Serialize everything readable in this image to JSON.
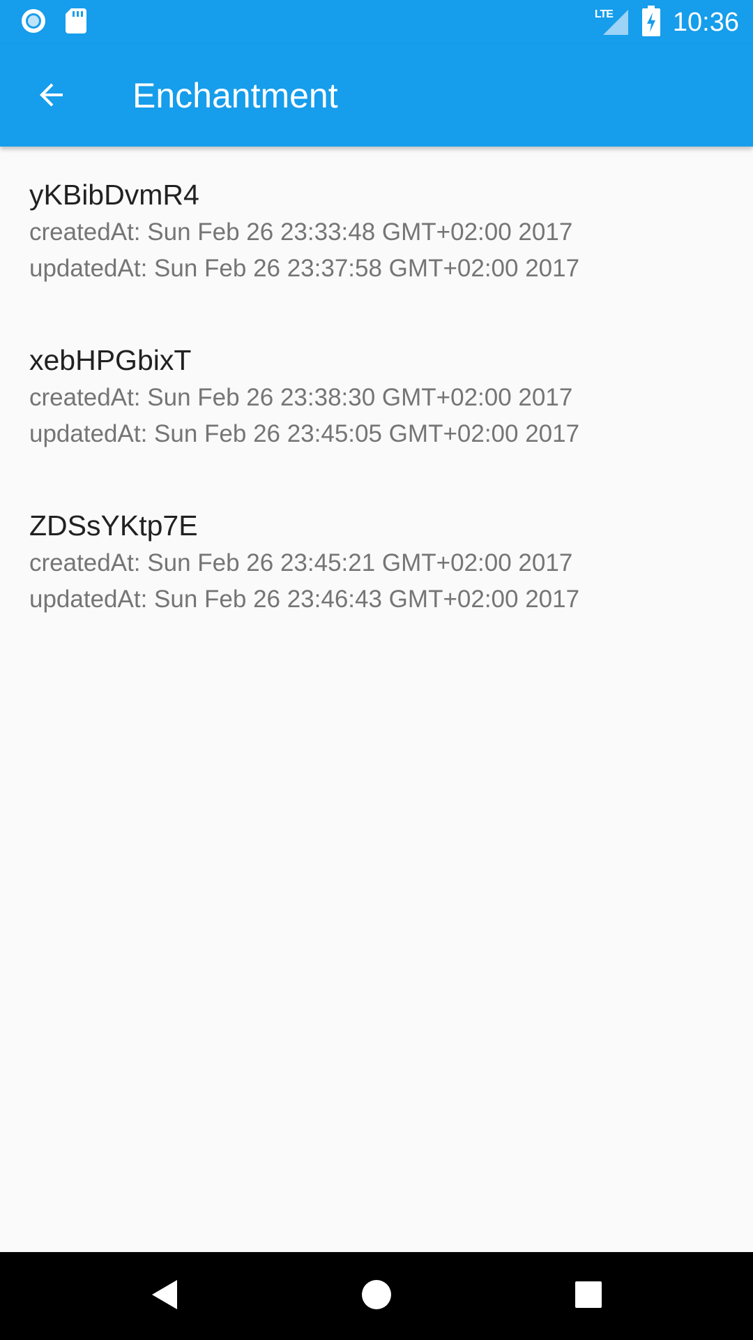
{
  "status_bar": {
    "time": "10:36",
    "network_label": "LTE",
    "icons": [
      "circle-notification-icon",
      "sd-card-icon",
      "lte-signal-icon",
      "battery-charging-icon"
    ]
  },
  "app_bar": {
    "title": "Enchantment",
    "back_icon": "arrow-back-icon"
  },
  "items": [
    {
      "title": "yKBibDvmR4",
      "created": "createdAt: Sun Feb 26 23:33:48 GMT+02:00 2017",
      "updated": "updatedAt: Sun Feb 26 23:37:58 GMT+02:00 2017"
    },
    {
      "title": "xebHPGbixT",
      "created": "createdAt: Sun Feb 26 23:38:30 GMT+02:00 2017",
      "updated": "updatedAt: Sun Feb 26 23:45:05 GMT+02:00 2017"
    },
    {
      "title": "ZDSsYKtp7E",
      "created": "createdAt: Sun Feb 26 23:45:21 GMT+02:00 2017",
      "updated": "updatedAt: Sun Feb 26 23:46:43 GMT+02:00 2017"
    }
  ],
  "nav_bar": {
    "icons": [
      "back-triangle-icon",
      "home-circle-icon",
      "recents-square-icon"
    ]
  },
  "colors": {
    "primary": "#169deb",
    "background": "#fafafa",
    "title_text": "#212121",
    "secondary_text": "#757575",
    "nav_bar": "#000000"
  }
}
